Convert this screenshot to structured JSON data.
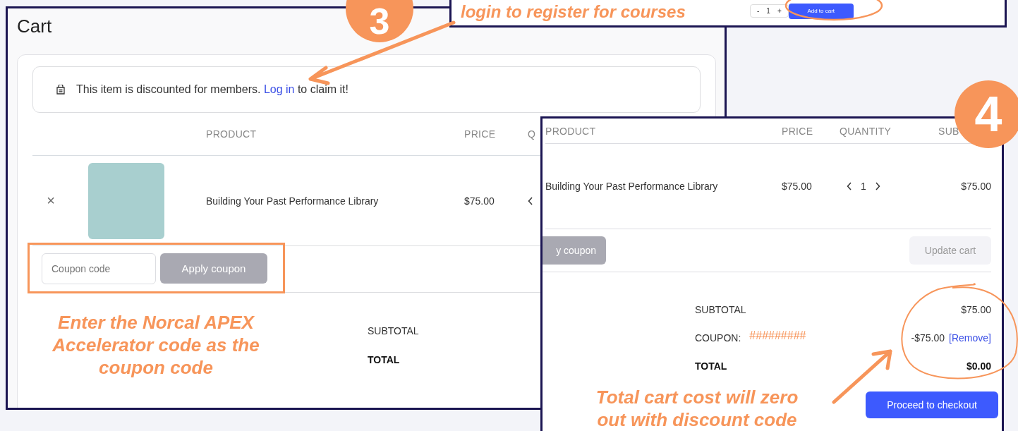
{
  "step_badges": [
    "3",
    "4"
  ],
  "top_panel": {
    "annotation": "login to register for courses",
    "quantity": {
      "minus": "-",
      "value": "1",
      "plus": "+"
    },
    "add_to_cart": "Add to cart"
  },
  "cart_panel": {
    "title": "Cart",
    "notice": {
      "text_before": "This item is discounted for members.",
      "link": "Log in",
      "text_after": "to claim it!"
    },
    "columns": [
      "PRODUCT",
      "PRICE",
      "Q"
    ],
    "item": {
      "remove": "×",
      "name": "Building Your Past Performance Library",
      "price": "$75.00"
    },
    "coupon": {
      "placeholder": "Coupon code",
      "apply_button": "Apply coupon"
    },
    "annotation": "Enter the Norcal APEX Accelerator code as the coupon code",
    "totals": [
      "SUBTOTAL",
      "TOTAL"
    ]
  },
  "result_panel": {
    "columns": [
      "PRODUCT",
      "PRICE",
      "QUANTITY",
      "SUB"
    ],
    "item": {
      "name": "Building Your Past Performance Library",
      "price": "$75.00",
      "quantity": "1",
      "subtotal": "$75.00"
    },
    "apply_button": "y coupon",
    "update_button": "Update cart",
    "totals": [
      {
        "kind": "plain",
        "label": "SUBTOTAL",
        "value": "$75.00"
      },
      {
        "kind": "coupon",
        "label": "COUPON:",
        "code": "#########",
        "value": "-$75.00",
        "link": "[Remove]"
      },
      {
        "kind": "total",
        "label": "TOTAL",
        "value": "$0.00"
      }
    ],
    "checkout_button": "Proceed to checkout",
    "annotation": "Total cart cost will zero out with discount code"
  }
}
